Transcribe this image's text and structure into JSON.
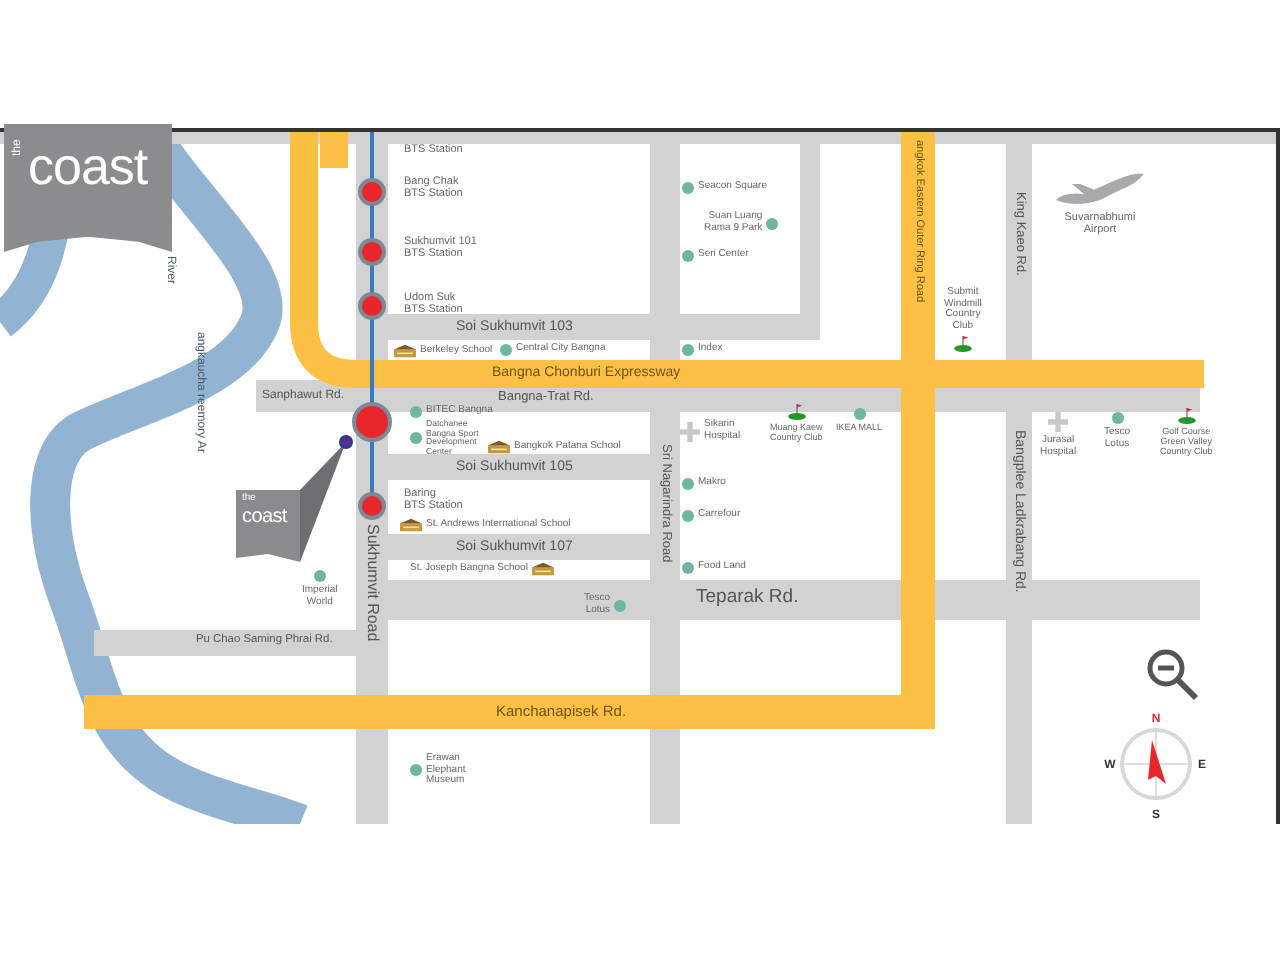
{
  "logo": {
    "prefix": "the",
    "name": "coast"
  },
  "map": {
    "river_labels": [
      "River",
      "angkaucha reemory Ar"
    ],
    "road_labels": [
      "Soi Sukhumvit 103",
      "Bangna Chonburi Expressway",
      "Sanphawut Rd.",
      "Bangna-Trat Rd.",
      "Soi Sukhumvit 105",
      "Soi Sukhumvit 107",
      "Teparak Rd.",
      "Pu Chao Saming Phrai Rd.",
      "Kanchanapisek Rd.",
      "Sukhumvit Road",
      "Sri Nagarindra Road",
      "angkok Eastern Outer Ring Road",
      "King Kaeo Rd.",
      "Bangplee Ladkrabang Rd."
    ],
    "places": [
      {
        "name": "BTS Station",
        "kind": "station"
      },
      {
        "name": "Bang Chak\nBTS Station",
        "kind": "station"
      },
      {
        "name": "Sukhumvit 101\nBTS Station",
        "kind": "station"
      },
      {
        "name": "Udom Suk\nBTS Station",
        "kind": "station"
      },
      {
        "name": "Baring\nBTS Station",
        "kind": "station"
      },
      {
        "name": "Seacon Square",
        "kind": "poi"
      },
      {
        "name": "Suan Luang\nRama 9 Park",
        "kind": "poi"
      },
      {
        "name": "Seri Center",
        "kind": "poi"
      },
      {
        "name": "Berkeley School",
        "kind": "school"
      },
      {
        "name": "Central City Bangna",
        "kind": "poi"
      },
      {
        "name": "Index",
        "kind": "poi"
      },
      {
        "name": "BITEC Bangna",
        "kind": "poi"
      },
      {
        "name": "Datchanee\nBangna Sport\nDevelopment\nCenter",
        "kind": "poi"
      },
      {
        "name": "Bangkok Patana School",
        "kind": "school"
      },
      {
        "name": "St. Andrews International School",
        "kind": "school"
      },
      {
        "name": "St. Joseph Bangna School",
        "kind": "school"
      },
      {
        "name": "Imperial\nWorld",
        "kind": "poi"
      },
      {
        "name": "Sikarin\nHospital",
        "kind": "hospital"
      },
      {
        "name": "Muang Kaew\nCountry Club",
        "kind": "golf"
      },
      {
        "name": "IKEA MALL",
        "kind": "poi"
      },
      {
        "name": "Makro",
        "kind": "poi"
      },
      {
        "name": "Carrefour",
        "kind": "poi"
      },
      {
        "name": "Food Land",
        "kind": "poi"
      },
      {
        "name": "Tesco\nLotus",
        "kind": "poi"
      },
      {
        "name": "Erawan\nElephant\nMuseum",
        "kind": "poi"
      },
      {
        "name": "Submit\nWindmill\nCountry\nClub",
        "kind": "golf"
      },
      {
        "name": "Suvarnabhumi\nAirport",
        "kind": "airport"
      },
      {
        "name": "Jurasal\nHospital",
        "kind": "hospital"
      },
      {
        "name": "Tesco\nLotus",
        "kind": "poi"
      },
      {
        "name": "Golf Course\nGreen Valley\nCountry Club",
        "kind": "golf"
      }
    ],
    "marker": {
      "prefix": "the",
      "name": "coast"
    }
  },
  "compass": {
    "north": "N",
    "east": "E",
    "south": "S",
    "west": "W"
  }
}
